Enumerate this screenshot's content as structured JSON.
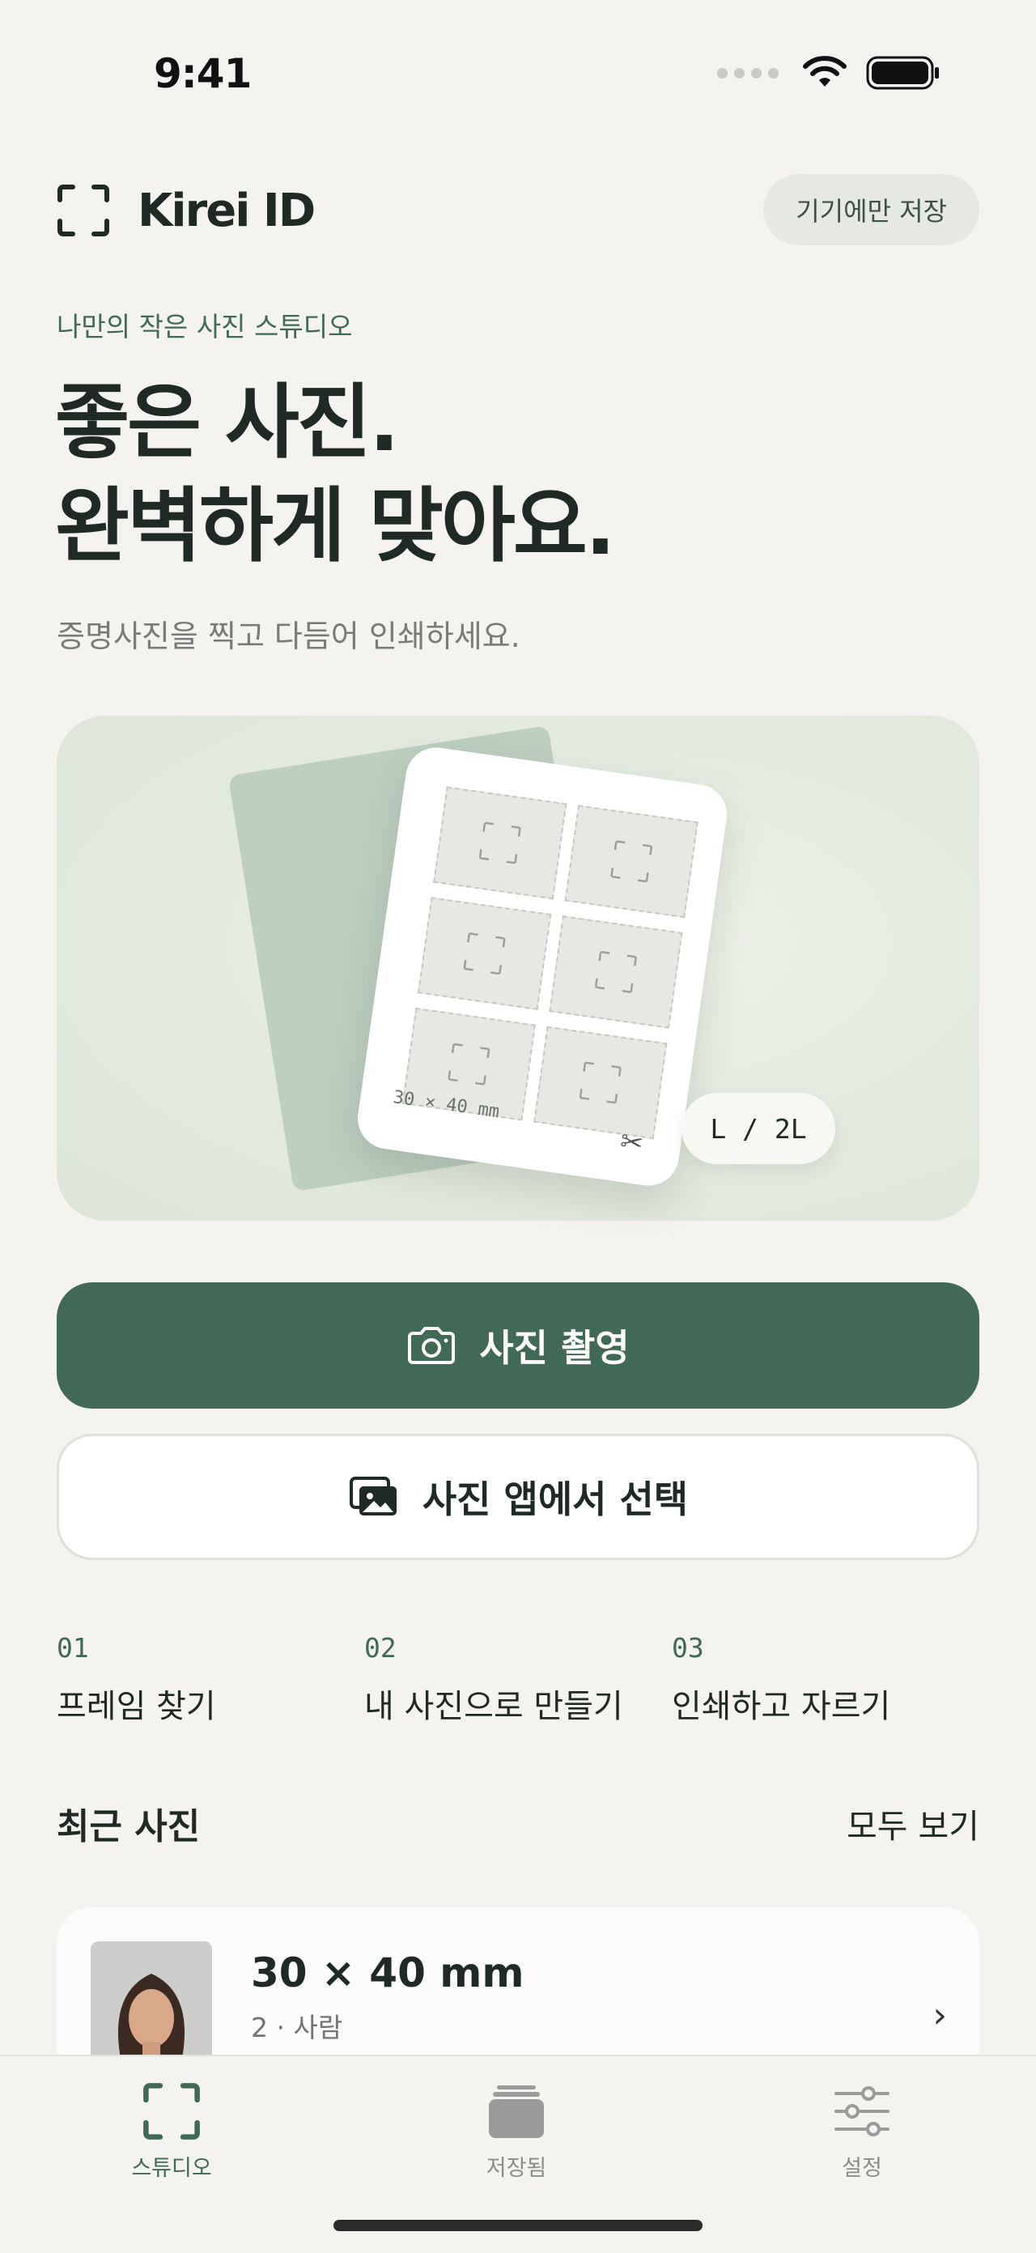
{
  "status_bar": {
    "time": "9:41"
  },
  "header": {
    "app_name": "Kirei ID",
    "device_only_label": "기기에만 저장"
  },
  "hero": {
    "tagline": "나만의 작은 사진 스튜디오",
    "title_line1": "좋은 사진.",
    "title_line2": "완벽하게 맞아요.",
    "subtitle": "증명사진을 찍고 다듬어 인쇄하세요.",
    "sheet_size": "30 × 40 mm",
    "paper_size": "L / 2L"
  },
  "actions": {
    "camera_label": "사진 촬영",
    "photos_label": "사진 앱에서 선택"
  },
  "steps": [
    {
      "number": "01",
      "label": "프레임 찾기"
    },
    {
      "number": "02",
      "label": "내 사진으로 만들기"
    },
    {
      "number": "03",
      "label": "인쇄하고 자르기"
    }
  ],
  "recent": {
    "title": "최근 사진",
    "see_all": "모두 보기",
    "items": [
      {
        "title": "30 × 40 mm",
        "subtitle": "2 · 사람"
      }
    ]
  },
  "tabs": [
    {
      "label": "스튜디오",
      "icon": "frame-icon",
      "active": true
    },
    {
      "label": "저장됨",
      "icon": "stack-icon",
      "active": false
    },
    {
      "label": "설정",
      "icon": "sliders-icon",
      "active": false
    }
  ],
  "colors": {
    "accent": "#406a56",
    "background": "#f4f3ef",
    "text": "#1f2a24",
    "tagline": "#3f6b52"
  }
}
